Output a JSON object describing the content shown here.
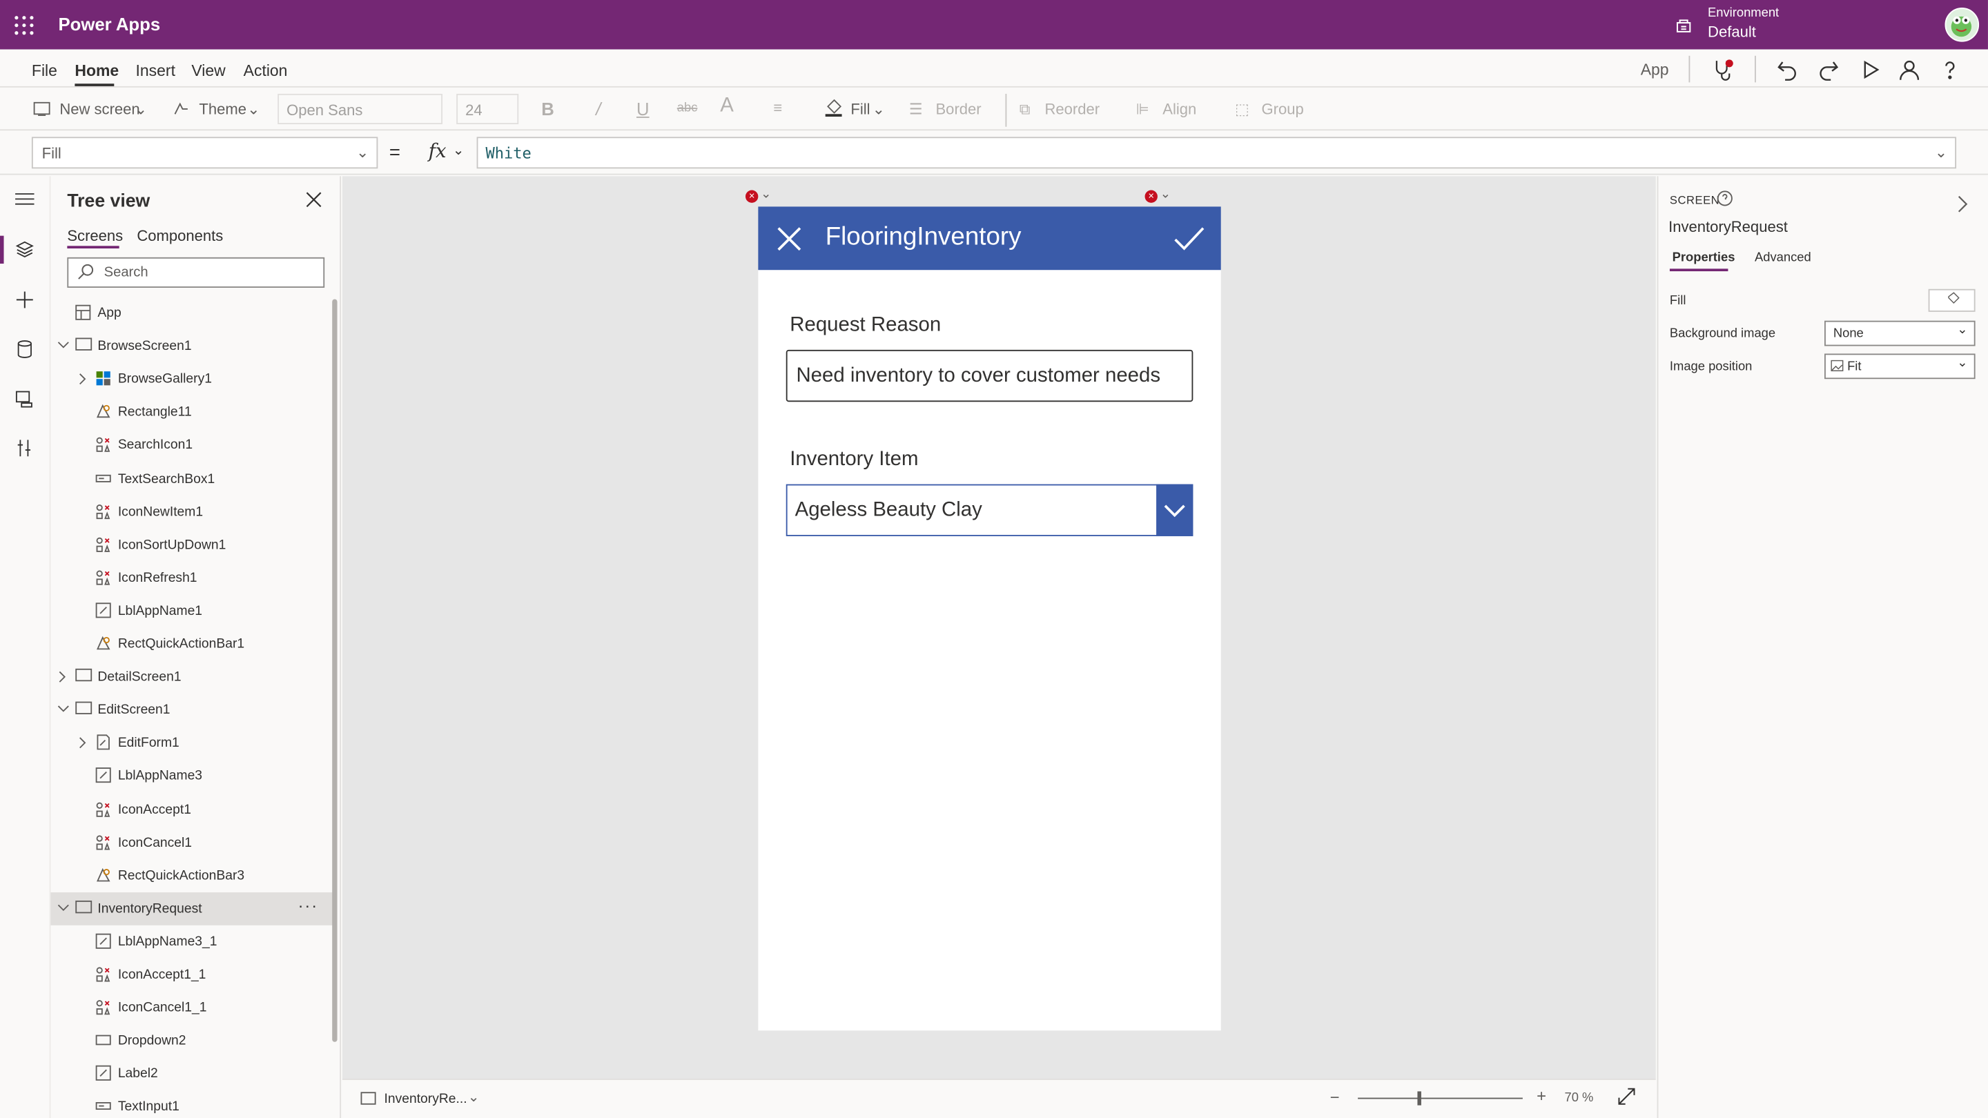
{
  "app": {
    "brand": "Power Apps"
  },
  "environment": {
    "label": "Environment",
    "value": "Default"
  },
  "menu": {
    "items": [
      "File",
      "Home",
      "Insert",
      "View",
      "Action"
    ],
    "active": "Home",
    "app_label": "App"
  },
  "toolbar": {
    "new_screen": "New screen",
    "theme": "Theme",
    "font": "Open Sans",
    "font_size": "24",
    "fill": "Fill",
    "border": "Border",
    "reorder": "Reorder",
    "align": "Align",
    "group": "Group"
  },
  "formula_bar": {
    "property": "Fill",
    "equals": "=",
    "fx": "fx",
    "formula": "White"
  },
  "tree": {
    "title": "Tree view",
    "tabs": [
      "Screens",
      "Components"
    ],
    "search_placeholder": "Search",
    "items": [
      {
        "label": "App",
        "level": 0,
        "icon": "app-icon",
        "chevron": "none"
      },
      {
        "label": "BrowseScreen1",
        "level": 0,
        "icon": "screen-icon",
        "chevron": "down"
      },
      {
        "label": "BrowseGallery1",
        "level": 1,
        "icon": "gallery-icon",
        "chevron": "right"
      },
      {
        "label": "Rectangle11",
        "level": 1,
        "icon": "shape-icon",
        "chevron": "none"
      },
      {
        "label": "SearchIcon1",
        "level": 1,
        "icon": "icons-icon",
        "chevron": "none"
      },
      {
        "label": "TextSearchBox1",
        "level": 1,
        "icon": "textinput-icon",
        "chevron": "none"
      },
      {
        "label": "IconNewItem1",
        "level": 1,
        "icon": "icons-icon",
        "chevron": "none"
      },
      {
        "label": "IconSortUpDown1",
        "level": 1,
        "icon": "icons-icon",
        "chevron": "none"
      },
      {
        "label": "IconRefresh1",
        "level": 1,
        "icon": "icons-icon",
        "chevron": "none"
      },
      {
        "label": "LblAppName1",
        "level": 1,
        "icon": "label-icon",
        "chevron": "none"
      },
      {
        "label": "RectQuickActionBar1",
        "level": 1,
        "icon": "shape-icon",
        "chevron": "none"
      },
      {
        "label": "DetailScreen1",
        "level": 0,
        "icon": "screen-icon",
        "chevron": "right"
      },
      {
        "label": "EditScreen1",
        "level": 0,
        "icon": "screen-icon",
        "chevron": "down"
      },
      {
        "label": "EditForm1",
        "level": 1,
        "icon": "form-icon",
        "chevron": "right"
      },
      {
        "label": "LblAppName3",
        "level": 1,
        "icon": "label-icon",
        "chevron": "none"
      },
      {
        "label": "IconAccept1",
        "level": 1,
        "icon": "icons-icon",
        "chevron": "none"
      },
      {
        "label": "IconCancel1",
        "level": 1,
        "icon": "icons-icon",
        "chevron": "none"
      },
      {
        "label": "RectQuickActionBar3",
        "level": 1,
        "icon": "shape-icon",
        "chevron": "none"
      },
      {
        "label": "InventoryRequest",
        "level": 0,
        "icon": "screen-icon",
        "chevron": "down",
        "selected": true
      },
      {
        "label": "LblAppName3_1",
        "level": 1,
        "icon": "label-icon",
        "chevron": "none"
      },
      {
        "label": "IconAccept1_1",
        "level": 1,
        "icon": "icons-icon",
        "chevron": "none"
      },
      {
        "label": "IconCancel1_1",
        "level": 1,
        "icon": "icons-icon",
        "chevron": "none"
      },
      {
        "label": "Dropdown2",
        "level": 1,
        "icon": "dropdown-icon",
        "chevron": "none"
      },
      {
        "label": "Label2",
        "level": 1,
        "icon": "label-icon",
        "chevron": "none"
      },
      {
        "label": "TextInput1",
        "level": 1,
        "icon": "textinput-icon",
        "chevron": "none"
      }
    ]
  },
  "canvas": {
    "app_title": "FlooringInventory",
    "request_reason_label": "Request Reason",
    "request_reason_value": "Need inventory to cover customer needs",
    "inventory_item_label": "Inventory Item",
    "inventory_item_value": "Ageless Beauty Clay"
  },
  "bottom_bar": {
    "screen": "InventoryRe...",
    "zoom": "70",
    "zoom_unit": "%"
  },
  "properties_panel": {
    "kind": "SCREEN",
    "name": "InventoryRequest",
    "tabs": [
      "Properties",
      "Advanced"
    ],
    "fill_label": "Fill",
    "background_image_label": "Background image",
    "background_image_value": "None",
    "image_position_label": "Image position",
    "image_position_value": "Fit"
  },
  "colors": {
    "brand": "#742774",
    "app_header": "#3a5ba9",
    "error": "#c50f1f"
  }
}
